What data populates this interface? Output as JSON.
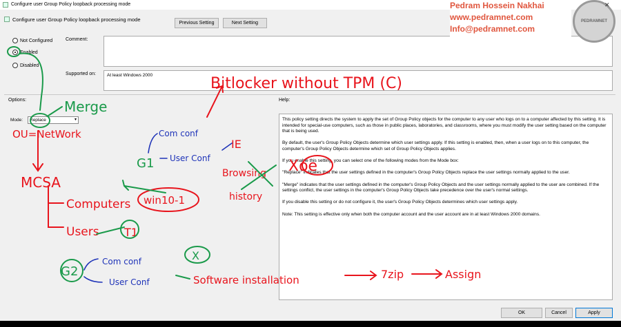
{
  "window": {
    "title": "Configure user Group Policy loopback processing mode",
    "policy_name": "Configure user Group Policy loopback processing mode",
    "minimize": "—",
    "maximize": "☐",
    "close": "✕"
  },
  "nav": {
    "previous": "Previous Setting",
    "next": "Next Setting"
  },
  "state": {
    "not_configured": "Not Configured",
    "enabled": "Enabled",
    "disabled": "Disabled",
    "selected": "Enabled"
  },
  "labels": {
    "comment": "Comment:",
    "supported_on": "Supported on:",
    "options": "Options:",
    "help": "Help:",
    "mode": "Mode:"
  },
  "supported_value": "At least Windows 2000",
  "mode_value": "Replace",
  "help": [
    "This policy setting directs the system to apply the set of Group Policy objects for the computer to any user who logs on to a computer affected by this setting. It is intended for special-use computers, such as those in public places, laboratories, and classrooms, where you must modify the user setting based on the computer that is being used.",
    "By default, the user's Group Policy Objects determine which user settings apply. If this setting is enabled, then, when a user logs on to this computer, the computer's Group Policy Objects determine which set of Group Policy Objects applies.",
    "If you enable this setting, you can select one of the following modes from the Mode box:",
    "\"Replace\" indicates that the user settings defined in the computer's Group Policy Objects replace the user settings normally applied to the user.",
    "\"Merge\" indicates that the user settings defined in the computer's Group Policy Objects and the user settings normally applied to the user are combined. If the settings conflict, the user settings in the computer's Group Policy Objects take precedence over the user's normal settings.",
    "If you disable this setting or do not configure it, the user's Group Policy Objects determines which user settings apply.",
    "Note: This setting is effective only when both the computer account and the user account are in at least Windows 2000 domains."
  ],
  "buttons": {
    "ok": "OK",
    "cancel": "Cancel",
    "apply": "Apply"
  },
  "watermark": {
    "name": "Pedram Hossein Nakhai",
    "site": "www.pedramnet.com",
    "email": "Info@pedramnet.com",
    "logo": "PEDRAMNET"
  },
  "annotations": {
    "bitlocker": "Bitlocker without TPM (C)",
    "merge": "Merge",
    "ou": "OU=NetWork",
    "mcsa": "MCSA",
    "computers": "Computers",
    "win10": "win10-1",
    "users": "Users",
    "t1": "T1",
    "g1": "G1",
    "com_conf_1": "Com conf",
    "user_conf_1": "User Conf",
    "ie": "IE",
    "browsing": "Browsing",
    "history": "history",
    "xoer": "Xoe",
    "g2": "G2",
    "com_conf_2": "Com conf",
    "user_conf_2": "User Conf",
    "x": "X",
    "software": "Software installation",
    "zip": "7zip",
    "assign": "Assign"
  },
  "colors": {
    "red_ink": "#e8141c",
    "green_ink": "#1a9a4a",
    "blue_ink": "#1e33b8",
    "watermark": "#e0563e"
  }
}
